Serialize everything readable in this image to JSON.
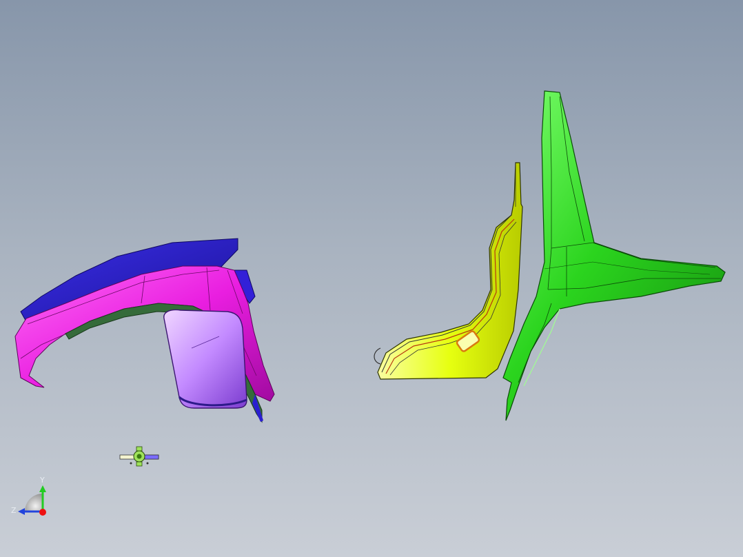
{
  "viewport": {
    "background_top": "#8796aa",
    "background_bottom": "#c9ced6"
  },
  "parts": [
    {
      "name": "seat-shell-left",
      "color": "#e91ee0",
      "accent": "#2a1ecf"
    },
    {
      "name": "seat-cushion",
      "color": "#c38aff"
    },
    {
      "name": "seat-side-profile",
      "color": "#e6ff10"
    },
    {
      "name": "seat-frame-star",
      "color": "#2bd41e"
    }
  ],
  "triad": {
    "y_label": "Y",
    "z_label": "Z",
    "y_color": "#22cc22",
    "z_color": "#2244dd",
    "origin_color": "#ee1111"
  }
}
